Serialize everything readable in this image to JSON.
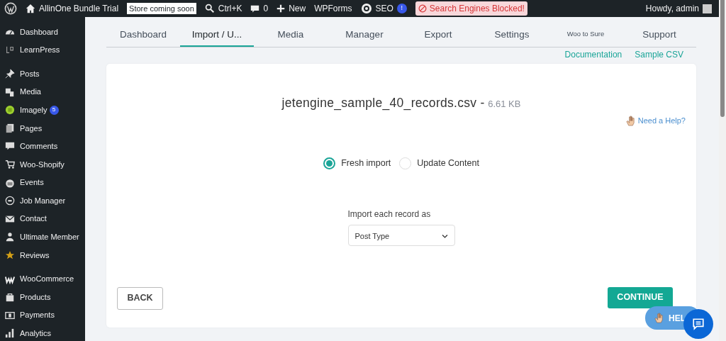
{
  "admin_bar": {
    "site": "AllinOne Bundle Trial",
    "store_badge": "Store coming soon",
    "search_shortcut": "Ctrl+K",
    "comments": "0",
    "new": "New",
    "wpforms": "WPForms",
    "seo": "SEO",
    "seo_badge": "!",
    "blocked_notice": "Search Engines Blocked!",
    "greeting": "Howdy, admin"
  },
  "sidebar": {
    "groups": [
      [
        {
          "label": "Dashboard"
        },
        {
          "label": "LearnPress"
        }
      ],
      [
        {
          "label": "Posts"
        },
        {
          "label": "Media"
        },
        {
          "label": "Imagely",
          "badge": "5"
        },
        {
          "label": "Pages"
        },
        {
          "label": "Comments"
        },
        {
          "label": "Woo-Shopify"
        },
        {
          "label": "Events"
        },
        {
          "label": "Job Manager"
        },
        {
          "label": "Contact"
        },
        {
          "label": "Ultimate Member"
        },
        {
          "label": "Reviews"
        }
      ],
      [
        {
          "label": "WooCommerce"
        },
        {
          "label": "Products"
        },
        {
          "label": "Payments"
        },
        {
          "label": "Analytics"
        }
      ]
    ]
  },
  "tabs": [
    {
      "label": "Dashboard",
      "selected": false
    },
    {
      "label": "Import / U...",
      "selected": true
    },
    {
      "label": "Media",
      "selected": false
    },
    {
      "label": "Manager",
      "selected": false
    },
    {
      "label": "Export",
      "selected": false
    },
    {
      "label": "Settings",
      "selected": false
    },
    {
      "label": "Woo to Sure",
      "selected": false,
      "kind": "small"
    },
    {
      "label": "Support",
      "selected": false
    }
  ],
  "links": [
    "Documentation",
    "Sample CSV"
  ],
  "file": {
    "name": "jetengine_sample_40_records.csv -",
    "size": "6.61 KB"
  },
  "help_link": "Need a Help?",
  "import_mode": [
    {
      "label": "Fresh import",
      "selected": true
    },
    {
      "label": "Update Content",
      "selected": false
    }
  ],
  "record_type": {
    "label": "Import each record as",
    "value": "Post Type"
  },
  "buttons": {
    "back": "BACK",
    "continue": "CONTINUE"
  },
  "help_fab": "HEL"
}
